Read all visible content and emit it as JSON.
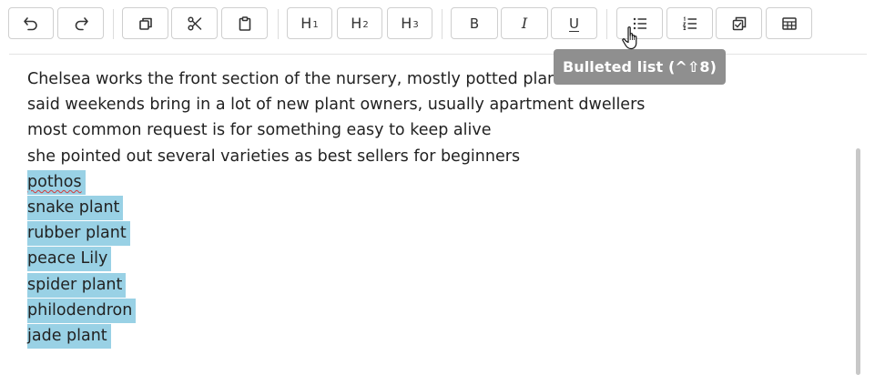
{
  "toolbar": {
    "buttons": [
      {
        "name": "undo",
        "icon": "undo-icon"
      },
      {
        "name": "redo",
        "icon": "redo-icon"
      },
      {
        "name": "copy",
        "icon": "copy-icon"
      },
      {
        "name": "cut",
        "icon": "scissors-icon"
      },
      {
        "name": "paste",
        "icon": "clipboard-icon"
      },
      {
        "name": "heading-1",
        "label": "H",
        "sub": "1"
      },
      {
        "name": "heading-2",
        "label": "H",
        "sub": "2"
      },
      {
        "name": "heading-3",
        "label": "H",
        "sub": "3"
      },
      {
        "name": "bold",
        "label": "B"
      },
      {
        "name": "italic",
        "label": "I"
      },
      {
        "name": "underline",
        "label": "U"
      },
      {
        "name": "bulleted-list",
        "icon": "bulleted-list-icon"
      },
      {
        "name": "numbered-list",
        "icon": "numbered-list-icon"
      },
      {
        "name": "checklist",
        "icon": "checklist-icon"
      },
      {
        "name": "table",
        "icon": "table-icon"
      }
    ]
  },
  "tooltip": {
    "text": "Bulleted list (^⇧8)"
  },
  "editor": {
    "lines": [
      "Chelsea works the front section of the nursery, mostly potted plants",
      "said weekends bring in a lot of new plant owners, usually apartment dwellers",
      "most common request is for something easy to keep alive",
      "she pointed out several varieties as best sellers for beginners"
    ],
    "selected_lines": [
      "pothos",
      "snake plant",
      "rubber plant",
      "peace Lily",
      "spider plant",
      "philodendron",
      "jade plant"
    ]
  },
  "colors": {
    "selection": "#99d1e5",
    "tooltip_bg": "#8f8f8f",
    "spellcheck": "#d43a3a"
  }
}
